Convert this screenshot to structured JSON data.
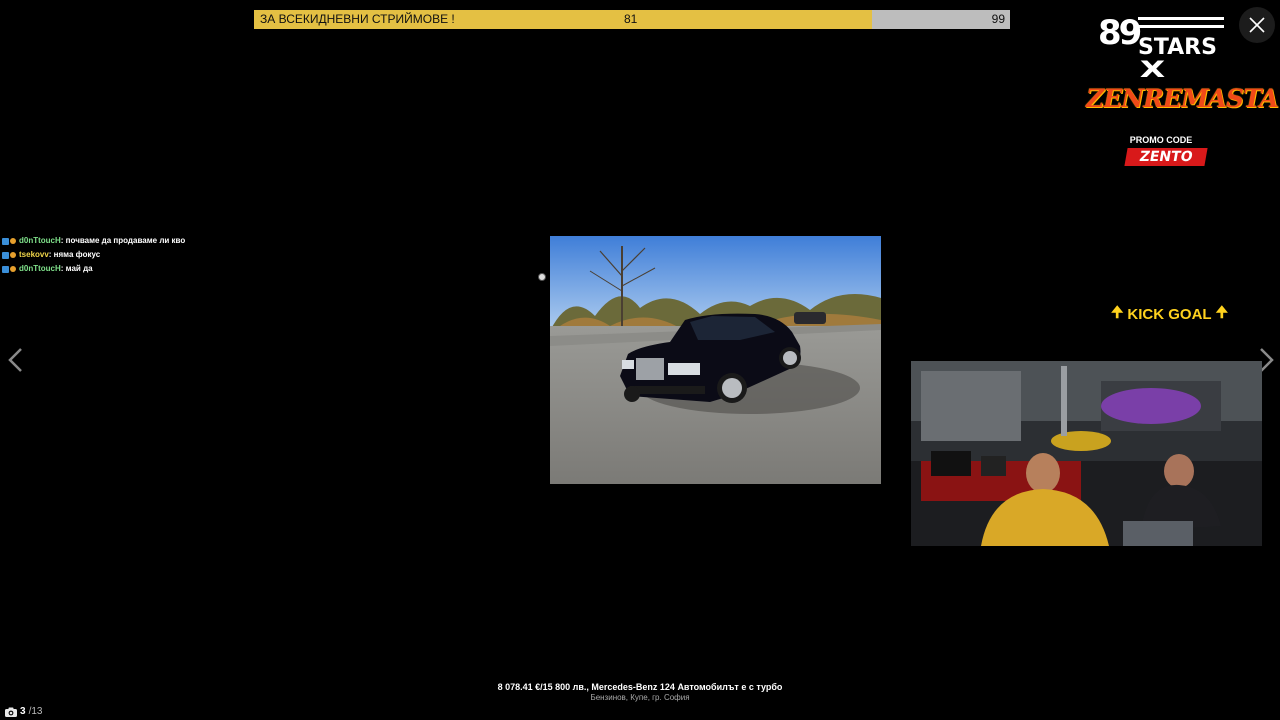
{
  "goal": {
    "label": "ЗА ВСЕКИДНЕВНИ СТРИЙМОВЕ !",
    "current": "81",
    "target": "99",
    "progress_fraction": 0.818,
    "fill_color": "#e4c043",
    "bg_color": "#bdbdbd"
  },
  "sponsor": {
    "number": "89",
    "stars": "STARS",
    "x": "X",
    "brand": "ZENREMASTA",
    "promo_label": "PROMO CODE",
    "promo_code": "ZENTO"
  },
  "chat": {
    "messages": [
      {
        "user": "d0nTtoucH",
        "text": ": почваме да продаваме ли кво",
        "color": "#7fe08a"
      },
      {
        "user": "tsekovv",
        "text": ": няма фокус",
        "color": "#f0d64a"
      },
      {
        "user": "d0nTtoucH",
        "text": ": май да",
        "color": "#7fe08a"
      }
    ]
  },
  "kick_goal": {
    "label": "KICK GOAL",
    "color": "#ffd21e"
  },
  "caption": {
    "title": "8 078.41 €/15 800 лв., Mercedes-Benz 124 Автомобилът е с турбо",
    "subtitle": "Бензинов, Купе, гр. София"
  },
  "counter": {
    "current": "3",
    "total": "/13"
  },
  "icons": {
    "close": "close-icon",
    "prev": "chevron-left-icon",
    "next": "chevron-right-icon",
    "camera": "camera-icon"
  }
}
